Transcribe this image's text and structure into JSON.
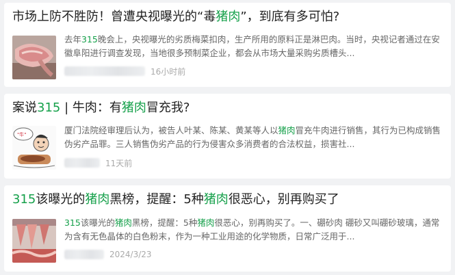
{
  "results": [
    {
      "title_segments": [
        {
          "text": "市场上防不胜防！曾遭央视曝光的“毒",
          "hl": false
        },
        {
          "text": "猪肉",
          "hl": true
        },
        {
          "text": "”，到底有多可怕?",
          "hl": false
        }
      ],
      "desc_segments": [
        {
          "text": "去年",
          "hl": false
        },
        {
          "text": "315",
          "hl": true
        },
        {
          "text": "晚会上，央视曝光的劣质梅菜扣肉，生产所用的原料正是淋巴肉。当时，央视记者通过在安徽阜阳进行调查发现，当地很多预制菜企业，都会从市场大量采购劣质槽头...",
          "hl": false
        }
      ],
      "time": "16小时前",
      "thumb_icon": "pork-meat-photo"
    },
    {
      "title_segments": [
        {
          "text": "案说",
          "hl": false
        },
        {
          "text": "315",
          "hl": true
        },
        {
          "text": " | 牛肉：有",
          "hl": false
        },
        {
          "text": "猪肉",
          "hl": true
        },
        {
          "text": "冒充我?",
          "hl": false
        }
      ],
      "desc_segments": [
        {
          "text": "厦门法院经审理后认为，被告人叶某、陈某、黄某等人以",
          "hl": false
        },
        {
          "text": "猪肉",
          "hl": true
        },
        {
          "text": "冒充牛肉进行销售，其行为已构成销售伪劣产品罪。三人销售伪劣产品的行为侵害众多消费者的合法权益，损害社...",
          "hl": false
        }
      ],
      "time": "11天前",
      "thumb_icon": "cartoon-illustration"
    },
    {
      "title_segments": [
        {
          "text": "315",
          "hl": true
        },
        {
          "text": "该曝光的",
          "hl": false
        },
        {
          "text": "猪肉",
          "hl": true
        },
        {
          "text": "黑榜，提醒：5种",
          "hl": false
        },
        {
          "text": "猪肉",
          "hl": true
        },
        {
          "text": "很恶心，别再购买了",
          "hl": false
        }
      ],
      "desc_segments": [
        {
          "text": "315",
          "hl": true
        },
        {
          "text": "该曝光的",
          "hl": false
        },
        {
          "text": "猪肉",
          "hl": true
        },
        {
          "text": "黑榜，提醒：5种",
          "hl": false
        },
        {
          "text": "猪肉",
          "hl": true
        },
        {
          "text": "很恶心，别再购买了。一、硼砂肉 硼砂又叫硼砂玻璃，通常为含有无色晶体的白色粉末，作为一种工业用途的化学物质，日常广泛用于...",
          "hl": false
        }
      ],
      "time": "2024/3/23",
      "thumb_icon": "meat-market-photo"
    }
  ],
  "colors": {
    "highlight": "#15a04a",
    "title": "#222222",
    "desc": "#666666",
    "meta": "#aaaaaa",
    "background": "#f1f2f4"
  }
}
